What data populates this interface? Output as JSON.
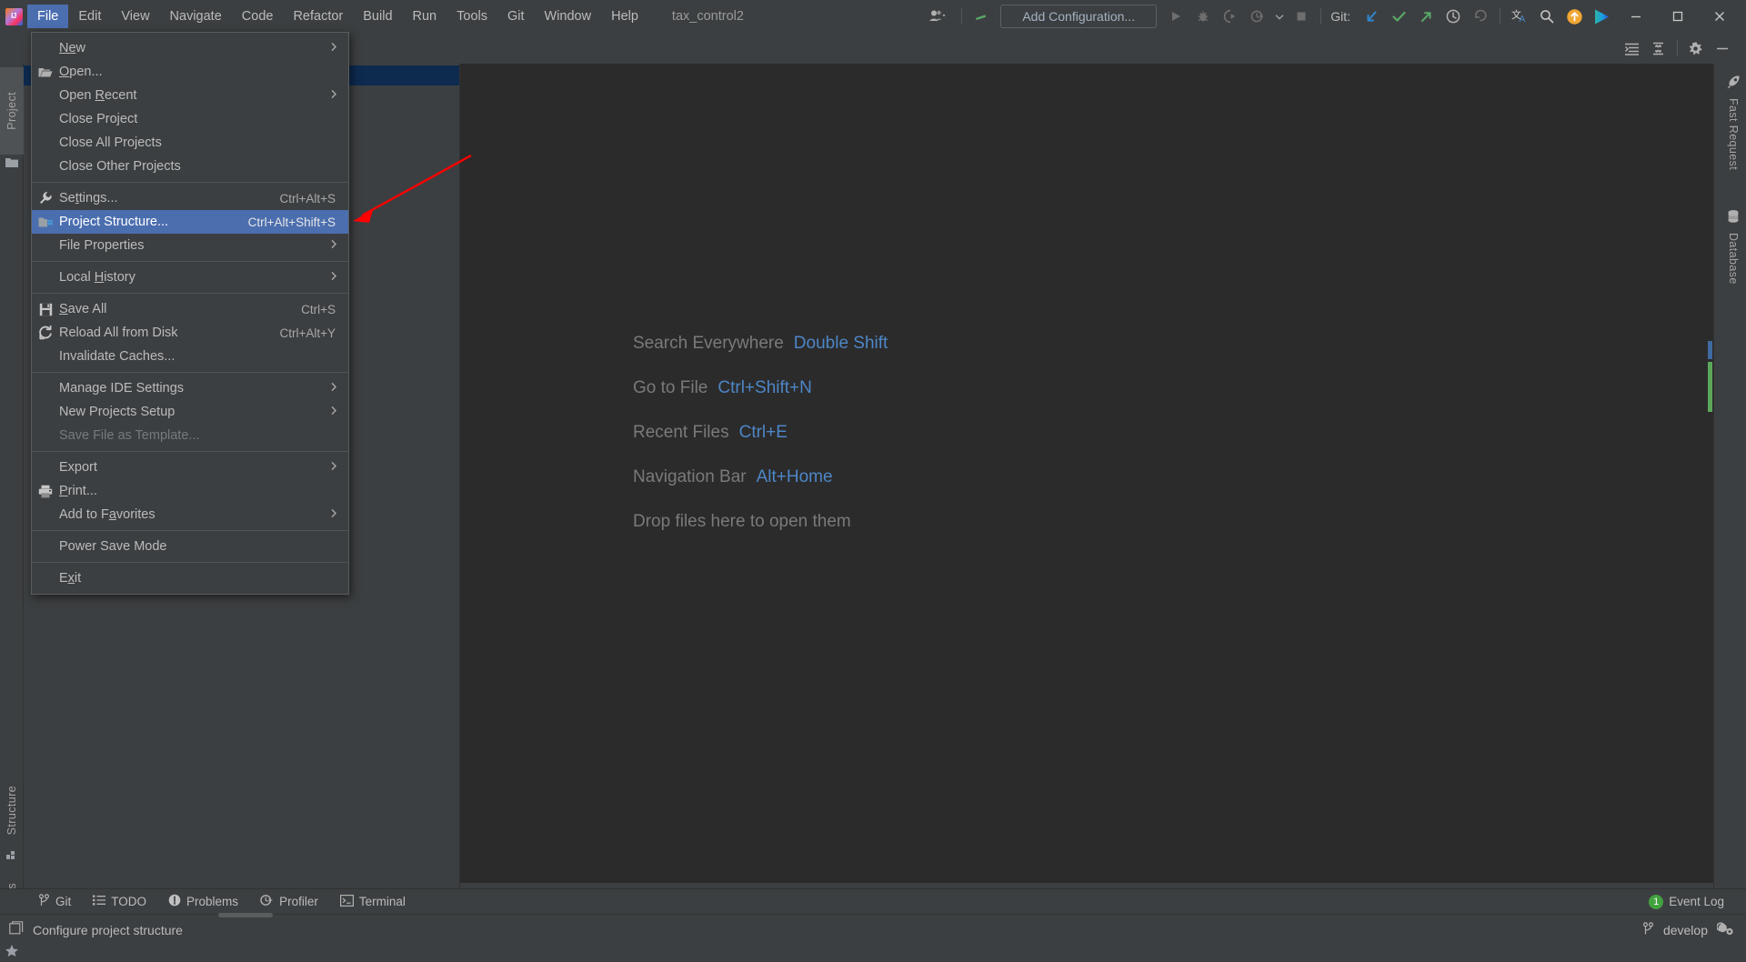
{
  "app": {
    "logo_text": "IJ",
    "project_name": "tax_control2"
  },
  "menubar": {
    "items": [
      {
        "label": "File",
        "mnemonic": "F",
        "active": true
      },
      {
        "label": "Edit",
        "mnemonic": "E",
        "active": false
      },
      {
        "label": "View",
        "mnemonic": "V",
        "active": false
      },
      {
        "label": "Navigate",
        "mnemonic": "N",
        "active": false
      },
      {
        "label": "Code",
        "mnemonic": "C",
        "active": false
      },
      {
        "label": "Refactor",
        "mnemonic": "R",
        "active": false
      },
      {
        "label": "Build",
        "mnemonic": "B",
        "active": false
      },
      {
        "label": "Run",
        "mnemonic": "u",
        "active": false
      },
      {
        "label": "Tools",
        "mnemonic": "T",
        "active": false
      },
      {
        "label": "Git",
        "mnemonic": "G",
        "active": false
      },
      {
        "label": "Window",
        "mnemonic": "W",
        "active": false
      },
      {
        "label": "Help",
        "mnemonic": "H",
        "active": false
      }
    ]
  },
  "window_controls": {
    "minimize": "minimize-icon",
    "maximize": "maximize-icon",
    "close": "close-icon"
  },
  "file_menu": {
    "items": [
      {
        "label": "New",
        "icon": "",
        "shortcut": "",
        "submenu": true,
        "separator_after": false,
        "disabled": false,
        "highlight": false
      },
      {
        "label": "Open...",
        "icon": "folder-open-icon",
        "shortcut": "",
        "submenu": false,
        "separator_after": false,
        "disabled": false,
        "highlight": false
      },
      {
        "label": "Open Recent",
        "icon": "",
        "shortcut": "",
        "submenu": true,
        "separator_after": false,
        "disabled": false,
        "highlight": false
      },
      {
        "label": "Close Project",
        "icon": "",
        "shortcut": "",
        "submenu": false,
        "separator_after": false,
        "disabled": false,
        "highlight": false
      },
      {
        "label": "Close All Projects",
        "icon": "",
        "shortcut": "",
        "submenu": false,
        "separator_after": false,
        "disabled": false,
        "highlight": false
      },
      {
        "label": "Close Other Projects",
        "icon": "",
        "shortcut": "",
        "submenu": false,
        "separator_after": true,
        "disabled": false,
        "highlight": false
      },
      {
        "label": "Settings...",
        "icon": "wrench-icon",
        "shortcut": "Ctrl+Alt+S",
        "submenu": false,
        "separator_after": false,
        "disabled": false,
        "highlight": false
      },
      {
        "label": "Project Structure...",
        "icon": "project-structure-icon",
        "shortcut": "Ctrl+Alt+Shift+S",
        "submenu": false,
        "separator_after": false,
        "disabled": false,
        "highlight": true
      },
      {
        "label": "File Properties",
        "icon": "",
        "shortcut": "",
        "submenu": true,
        "separator_after": true,
        "disabled": false,
        "highlight": false
      },
      {
        "label": "Local History",
        "icon": "",
        "shortcut": "",
        "submenu": true,
        "separator_after": true,
        "disabled": false,
        "highlight": false
      },
      {
        "label": "Save All",
        "icon": "save-icon",
        "shortcut": "Ctrl+S",
        "submenu": false,
        "separator_after": false,
        "disabled": false,
        "highlight": false
      },
      {
        "label": "Reload All from Disk",
        "icon": "refresh-icon",
        "shortcut": "Ctrl+Alt+Y",
        "submenu": false,
        "separator_after": false,
        "disabled": false,
        "highlight": false
      },
      {
        "label": "Invalidate Caches...",
        "icon": "",
        "shortcut": "",
        "submenu": false,
        "separator_after": true,
        "disabled": false,
        "highlight": false
      },
      {
        "label": "Manage IDE Settings",
        "icon": "",
        "shortcut": "",
        "submenu": true,
        "separator_after": false,
        "disabled": false,
        "highlight": false
      },
      {
        "label": "New Projects Setup",
        "icon": "",
        "shortcut": "",
        "submenu": true,
        "separator_after": false,
        "disabled": false,
        "highlight": false
      },
      {
        "label": "Save File as Template...",
        "icon": "",
        "shortcut": "",
        "submenu": false,
        "separator_after": true,
        "disabled": true,
        "highlight": false
      },
      {
        "label": "Export",
        "icon": "",
        "shortcut": "",
        "submenu": true,
        "separator_after": false,
        "disabled": false,
        "highlight": false
      },
      {
        "label": "Print...",
        "icon": "printer-icon",
        "shortcut": "",
        "submenu": false,
        "separator_after": false,
        "disabled": false,
        "highlight": false
      },
      {
        "label": "Add to Favorites",
        "icon": "",
        "shortcut": "",
        "submenu": true,
        "separator_after": true,
        "disabled": false,
        "highlight": false
      },
      {
        "label": "Power Save Mode",
        "icon": "",
        "shortcut": "",
        "submenu": false,
        "separator_after": true,
        "disabled": false,
        "highlight": false
      },
      {
        "label": "Exit",
        "icon": "",
        "shortcut": "",
        "submenu": false,
        "separator_after": false,
        "disabled": false,
        "highlight": false
      }
    ],
    "mnemonics": {
      "New": "Ne",
      "Open...": "O",
      "Open Recent": "R",
      "Settings...": "t",
      "Local History": "H",
      "Save All": "S",
      "Print...": "P",
      "Add to Favorites": "a",
      "Exit": "x"
    }
  },
  "toolbar": {
    "user_icon": "user-dropdown-icon",
    "build_icon": "build-hammer-icon",
    "run_config_label": "Add Configuration...",
    "run_icon": "run-icon",
    "debug_icon": "debug-icon",
    "run_coverage_icon": "run-with-coverage-icon",
    "profile_icon": "profiler-icon",
    "dropdown_icon": "chevron-down-icon",
    "stop_icon": "stop-icon",
    "git_label": "Git:",
    "git_update_icon": "update-project-icon",
    "git_commit_icon": "commit-icon",
    "git_push_icon": "push-icon",
    "history_icon": "history-icon",
    "undo_icon": "rollback-icon",
    "translate_icon": "translate-icon",
    "search_icon": "search-icon",
    "upload_icon": "upload-circle-icon",
    "play_icon": "play-gradient-icon"
  },
  "project_toolbar": {
    "expand_icon": "expand-all-icon",
    "collapse_icon": "collapse-all-icon",
    "settings_icon": "gear-icon",
    "hide_icon": "hide-panel-icon",
    "chevron_icon": "chevron-right-icon",
    "folder_icon": "folder-icon"
  },
  "left_tool_strip": {
    "tabs": [
      {
        "label": "Project",
        "icon": "project-folder-icon",
        "selected": true
      },
      {
        "label": "Structure",
        "icon": "structure-icon",
        "selected": false
      },
      {
        "label": "Favorites",
        "icon": "star-icon",
        "selected": false
      }
    ]
  },
  "right_tool_strip": {
    "tabs": [
      {
        "label": "Fast Request",
        "icon": "rocket-icon"
      },
      {
        "label": "Database",
        "icon": "database-icon"
      }
    ]
  },
  "editor": {
    "welcome_rows": [
      {
        "text": "Search Everywhere",
        "key": "Double Shift"
      },
      {
        "text": "Go to File",
        "key": "Ctrl+Shift+N"
      },
      {
        "text": "Recent Files",
        "key": "Ctrl+E"
      },
      {
        "text": "Navigation Bar",
        "key": "Alt+Home"
      },
      {
        "text": "Drop files here to open them",
        "key": ""
      }
    ]
  },
  "bottom_tabs": {
    "items": [
      {
        "label": "Git",
        "icon": "git-branch-icon"
      },
      {
        "label": "TODO",
        "icon": "todo-list-icon"
      },
      {
        "label": "Problems",
        "icon": "problems-icon"
      },
      {
        "label": "Profiler",
        "icon": "profiler-icon"
      },
      {
        "label": "Terminal",
        "icon": "terminal-icon"
      }
    ],
    "event_log": {
      "label": "Event Log",
      "count": "1"
    }
  },
  "statusbar": {
    "message": "Configure project structure",
    "message_icon": "window-icon",
    "branch": "develop",
    "branch_icon": "git-branch-icon",
    "help_icon": "help-gear-icon"
  },
  "colors": {
    "accent_blue": "#4b6eaf",
    "link_blue": "#4e86c7",
    "panel_bg": "#3c3f41",
    "editor_bg": "#2b2b2b",
    "annotation_red": "#ff0000",
    "green": "#42a23f"
  }
}
